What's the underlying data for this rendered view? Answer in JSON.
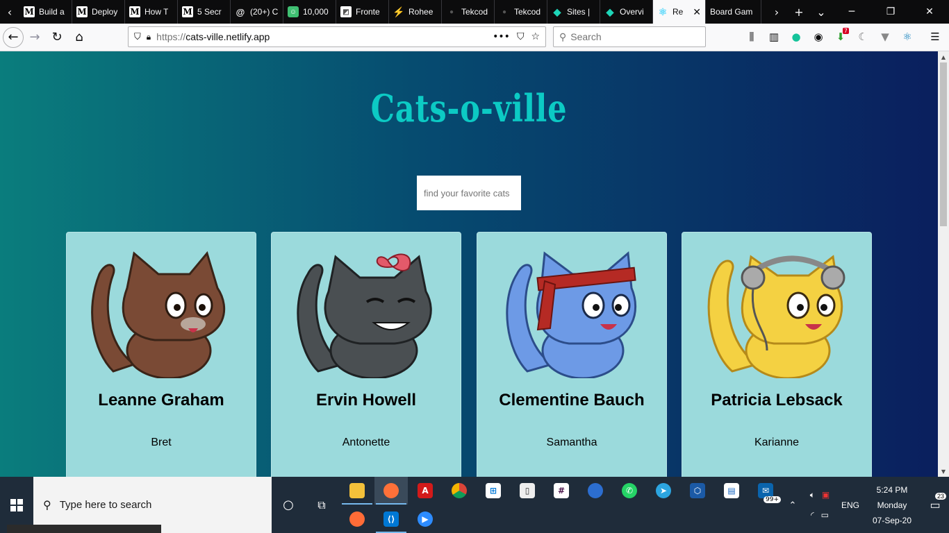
{
  "browser": {
    "tabs": [
      {
        "title": "Build a",
        "favicon": "medium-icon"
      },
      {
        "title": "Deploy",
        "favicon": "medium-icon"
      },
      {
        "title": "How T",
        "favicon": "medium-icon"
      },
      {
        "title": "5 Secr",
        "favicon": "medium-icon"
      },
      {
        "title": "(20+) C",
        "favicon": "at-icon"
      },
      {
        "title": "10,000",
        "favicon": "owl-icon"
      },
      {
        "title": "Fronte",
        "favicon": "frontend-icon"
      },
      {
        "title": "Rohee",
        "favicon": "bolt-icon"
      },
      {
        "title": "Tekcod",
        "favicon": "dark-icon"
      },
      {
        "title": "Tekcod",
        "favicon": "dark-icon"
      },
      {
        "title": "Sites |",
        "favicon": "netlify-icon"
      },
      {
        "title": "Overvi",
        "favicon": "netlify-icon"
      },
      {
        "title": "Re",
        "favicon": "react-icon",
        "active": true
      },
      {
        "title": "Board Gam",
        "favicon": "",
        "active": false
      }
    ],
    "url_prefix": "https://",
    "url_host": "cats-ville.netlify.app",
    "search_placeholder": "Search",
    "extension_badge": "7"
  },
  "page": {
    "title": "Cats-o-ville",
    "search_placeholder": "find your favorite cats",
    "cards": [
      {
        "name": "Leanne Graham",
        "username": "Bret",
        "color": "#7a4a35"
      },
      {
        "name": "Ervin Howell",
        "username": "Antonette",
        "color": "#4a4f52"
      },
      {
        "name": "Clementine Bauch",
        "username": "Samantha",
        "color": "#6d9ae6"
      },
      {
        "name": "Patricia Lebsack",
        "username": "Karianne",
        "color": "#f4d142"
      }
    ]
  },
  "taskbar": {
    "search_placeholder": "Type here to search",
    "mail_badge": "99+",
    "language": "ENG",
    "time": "5:24 PM",
    "day": "Monday",
    "date": "07-Sep-20",
    "notification_count": "23"
  },
  "colors": {
    "title": "#0ccac4",
    "card_bg": "#9bdadc",
    "gradient_left": "#0a7d7d",
    "gradient_right": "#0a1f5e"
  }
}
